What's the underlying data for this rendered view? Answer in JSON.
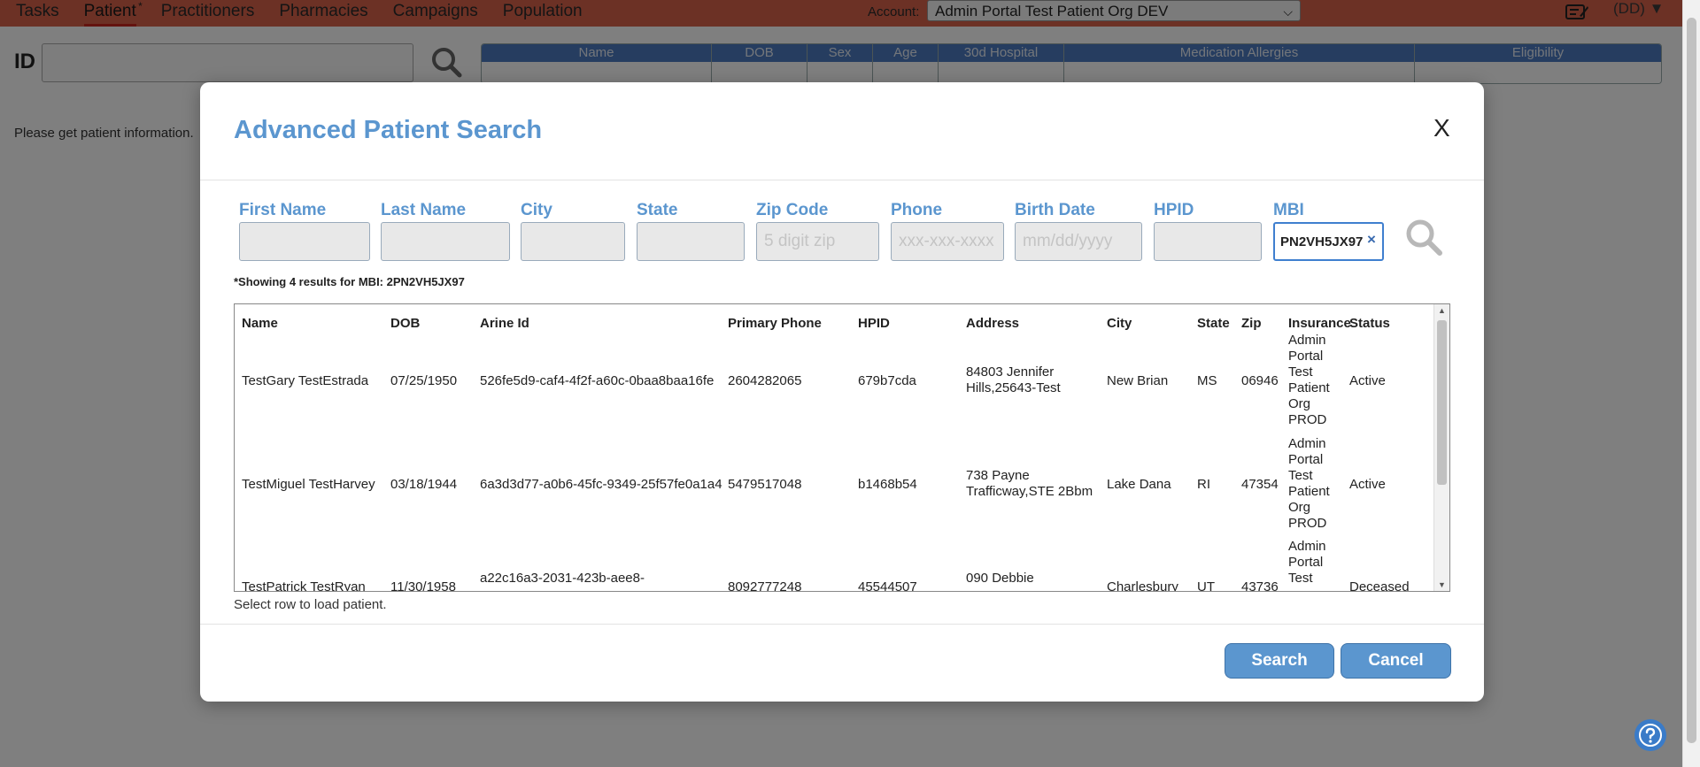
{
  "nav": {
    "tabs": [
      "Tasks",
      "Patient",
      "Practitioners",
      "Pharmacies",
      "Campaigns",
      "Population"
    ],
    "active_marker": "*",
    "account_label": "Account:",
    "account_value": "Admin Portal Test Patient Org DEV",
    "user_initials": "(DD)"
  },
  "page": {
    "id_label": "ID",
    "id_value": "",
    "table_headers": [
      "Name",
      "DOB",
      "Sex",
      "Age",
      "30d Hospital",
      "Medication Allergies",
      "Eligibility"
    ],
    "message": "Please get patient information."
  },
  "modal": {
    "title": "Advanced Patient Search",
    "close_label": "X",
    "fields": [
      {
        "label": "First Name",
        "value": "",
        "placeholder": ""
      },
      {
        "label": "Last Name",
        "value": "",
        "placeholder": ""
      },
      {
        "label": "City",
        "value": "",
        "placeholder": ""
      },
      {
        "label": "State",
        "value": "",
        "placeholder": ""
      },
      {
        "label": "Zip Code",
        "value": "",
        "placeholder": "5 digit zip"
      },
      {
        "label": "Phone",
        "value": "",
        "placeholder": "xxx-xxx-xxxx"
      },
      {
        "label": "Birth Date",
        "value": "",
        "placeholder": "mm/dd/yyyy"
      },
      {
        "label": "HPID",
        "value": "",
        "placeholder": ""
      },
      {
        "label": "MBI",
        "value": "PN2VH5JX97",
        "placeholder": ""
      }
    ],
    "mbi_clear": "×",
    "results_note": "*Showing 4 results for MBI: 2PN2VH5JX97",
    "columns": [
      "Name",
      "DOB",
      "Arine Id",
      "Primary Phone",
      "HPID",
      "Address",
      "City",
      "State",
      "Zip",
      "Insurance",
      "Status"
    ],
    "rows": [
      {
        "name": "TestGary TestEstrada",
        "dob": "07/25/1950",
        "arine_id": "526fe5d9-caf4-4f2f-a60c-0baa8baa16fe",
        "phone": "2604282065",
        "hpid": "679b7cda",
        "address": "84803 Jennifer Hills,25643-Test",
        "city": "New Brian",
        "state": "MS",
        "zip": "06946",
        "insurance": "Admin Portal Test Patient Org PROD",
        "status": "Active"
      },
      {
        "name": "TestMiguel TestHarvey",
        "dob": "03/18/1944",
        "arine_id": "6a3d3d77-a0b6-45fc-9349-25f57fe0a1a4",
        "phone": "5479517048",
        "hpid": "b1468b54",
        "address": "738 Payne Trafficway,STE 2Bbm",
        "city": "Lake Dana",
        "state": "RI",
        "zip": "47354",
        "insurance": "Admin Portal Test Patient Org PROD",
        "status": "Active"
      },
      {
        "name": "TestPatrick TestRyan",
        "dob": "11/30/1958",
        "arine_id": "a22c16a3-2031-423b-aee8-",
        "phone": "8092777248",
        "hpid": "45544507",
        "address": "090 Debbie",
        "city": "Charlesbury",
        "state": "UT",
        "zip": "43736",
        "insurance": "Admin Portal Test",
        "status": "Deceased"
      }
    ],
    "select_hint": "Select row to load patient.",
    "search_button": "Search",
    "cancel_button": "Cancel"
  },
  "colors": {
    "nav_bg": "#d9624a",
    "accent": "#5b96cf",
    "table_header": "#4c7ac0"
  }
}
